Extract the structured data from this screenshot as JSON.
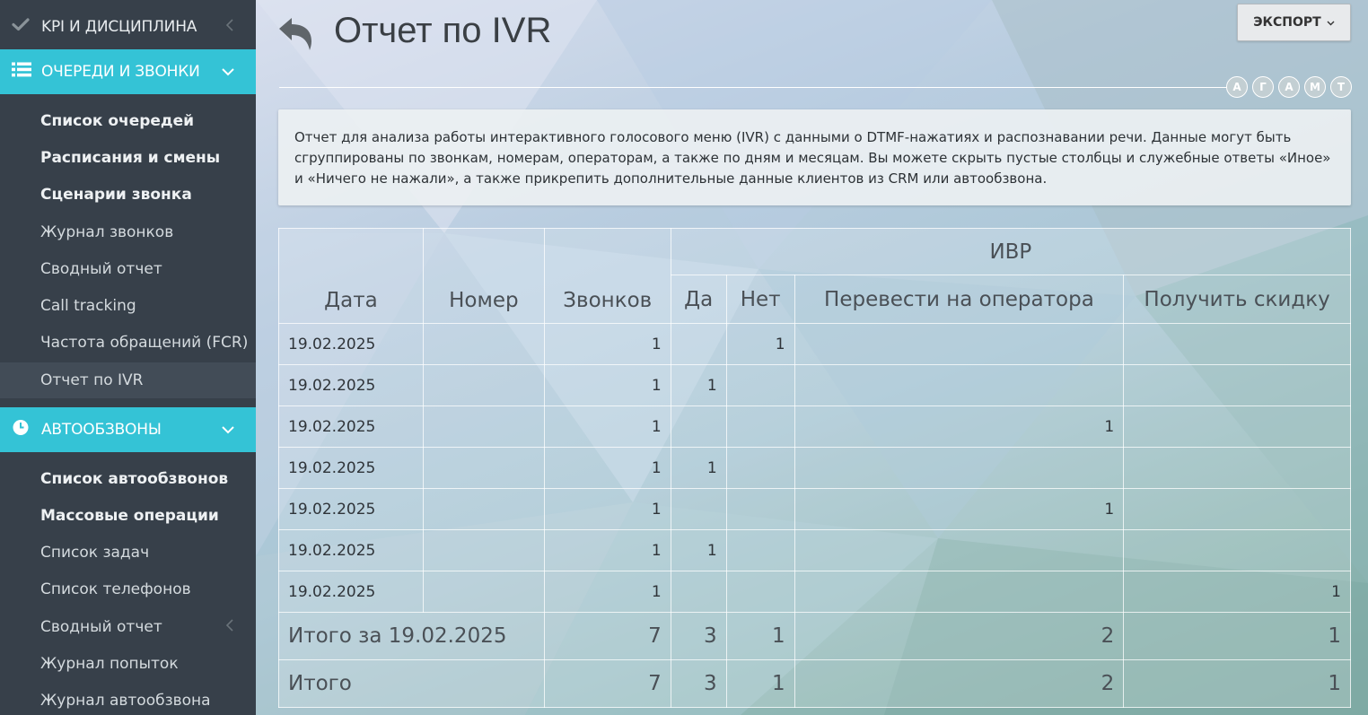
{
  "sidebar": {
    "kpi": {
      "label": "KPI И ДИСЦИПЛИНА"
    },
    "queues": {
      "label": "ОЧЕРЕДИ И ЗВОНКИ",
      "items": [
        {
          "label": "Список очередей"
        },
        {
          "label": "Расписания и смены"
        },
        {
          "label": "Сценарии звонка"
        },
        {
          "label": "Журнал звонков"
        },
        {
          "label": "Сводный отчет"
        },
        {
          "label": "Call tracking"
        },
        {
          "label": "Частота обращений (FCR)"
        },
        {
          "label": "Отчет по IVR"
        }
      ]
    },
    "autodial": {
      "label": "АВТООБЗВОНЫ",
      "items": [
        {
          "label": "Список автообзвонов"
        },
        {
          "label": "Массовые операции"
        },
        {
          "label": "Список задач"
        },
        {
          "label": "Список телефонов"
        },
        {
          "label": "Сводный отчет"
        },
        {
          "label": "Журнал попыток"
        },
        {
          "label": "Журнал автообзвона"
        }
      ]
    }
  },
  "header": {
    "title": "Отчет по IVR",
    "export_label": "ЭКСПОРТ",
    "font_buttons": [
      "А",
      "Г",
      "А",
      "М",
      "Т"
    ]
  },
  "description": "Отчет для анализа работы интерактивного голосового меню (IVR) с данными о DTMF-нажатиях и распознавании речи. Данные могут быть сгруппированы по звонкам, номерам, операторам, а также по дням и месяцам. Вы можете скрыть пустые столбцы и служебные ответы «Иное» и «Ничего не нажали», а также прикрепить дополнительные данные клиентов из CRM или автообзвона.",
  "table": {
    "group_header": "ИВР",
    "columns": [
      "Дата",
      "Номер",
      "Звонков",
      "Да",
      "Нет",
      "Перевести на оператора",
      "Получить скидку"
    ],
    "rows": [
      [
        "19.02.2025",
        "",
        "1",
        "",
        "1",
        "",
        ""
      ],
      [
        "19.02.2025",
        "",
        "1",
        "1",
        "",
        "",
        ""
      ],
      [
        "19.02.2025",
        "",
        "1",
        "",
        "",
        "1",
        ""
      ],
      [
        "19.02.2025",
        "",
        "1",
        "1",
        "",
        "",
        ""
      ],
      [
        "19.02.2025",
        "",
        "1",
        "",
        "",
        "1",
        ""
      ],
      [
        "19.02.2025",
        "",
        "1",
        "1",
        "",
        "",
        ""
      ],
      [
        "19.02.2025",
        "",
        "1",
        "",
        "",
        "",
        "1"
      ]
    ],
    "subtotal": [
      "Итого за 19.02.2025",
      "7",
      "3",
      "1",
      "2",
      "1"
    ],
    "total": [
      "Итого",
      "7",
      "3",
      "1",
      "2",
      "1"
    ]
  }
}
